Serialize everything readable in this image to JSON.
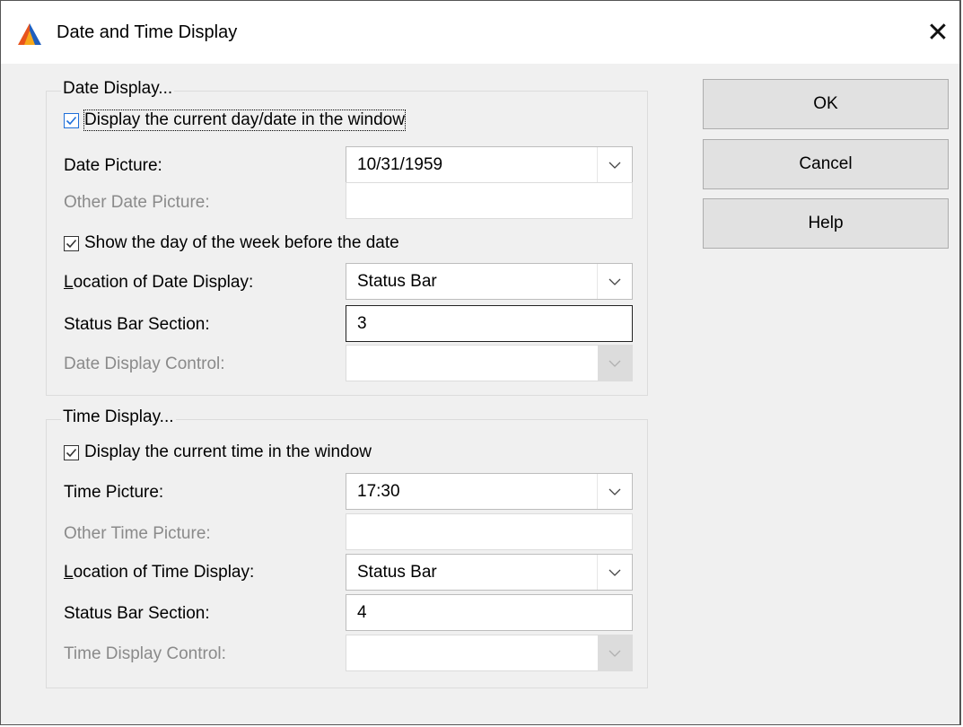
{
  "window": {
    "title": "Date and Time Display",
    "close_glyph": "✕"
  },
  "date_group": {
    "title": "Date Display...",
    "display_date_checkbox": {
      "label": "Display the current day/date in the window",
      "checked": true
    },
    "date_picture": {
      "label": "Date Picture:",
      "value": "10/31/1959"
    },
    "other_date_picture": {
      "label": "Other Date Picture:",
      "value": ""
    },
    "show_day_checkbox": {
      "label": "Show the day of the week before the date",
      "checked": true
    },
    "location": {
      "label_first": "L",
      "label_rest": "ocation of Date Display:",
      "value": "Status Bar"
    },
    "status_bar_section": {
      "label": "Status Bar Section:",
      "value": "3"
    },
    "display_control": {
      "label": "Date Display Control:",
      "value": ""
    }
  },
  "time_group": {
    "title": "Time Display...",
    "display_time_checkbox": {
      "label": "Display the current time in the window",
      "checked": true
    },
    "time_picture": {
      "label": "Time Picture:",
      "value": "17:30"
    },
    "other_time_picture": {
      "label": "Other Time Picture:",
      "value": ""
    },
    "location": {
      "label_first": "L",
      "label_rest": "ocation of Time Display:",
      "value": "Status Bar"
    },
    "status_bar_section": {
      "label": "Status Bar Section:",
      "value": "4"
    },
    "display_control": {
      "label": "Time Display Control:",
      "value": ""
    }
  },
  "buttons": {
    "ok": "OK",
    "cancel": "Cancel",
    "help": "Help"
  },
  "colors": {
    "accent": "#1e6fd9",
    "disabled_text": "#8a8a8a",
    "dialog_bg": "#f0f0f0"
  },
  "icons": {
    "app": "app-logo-icon",
    "close": "close-icon",
    "dropdown": "chevron-down-icon",
    "check": "checkmark-icon"
  }
}
